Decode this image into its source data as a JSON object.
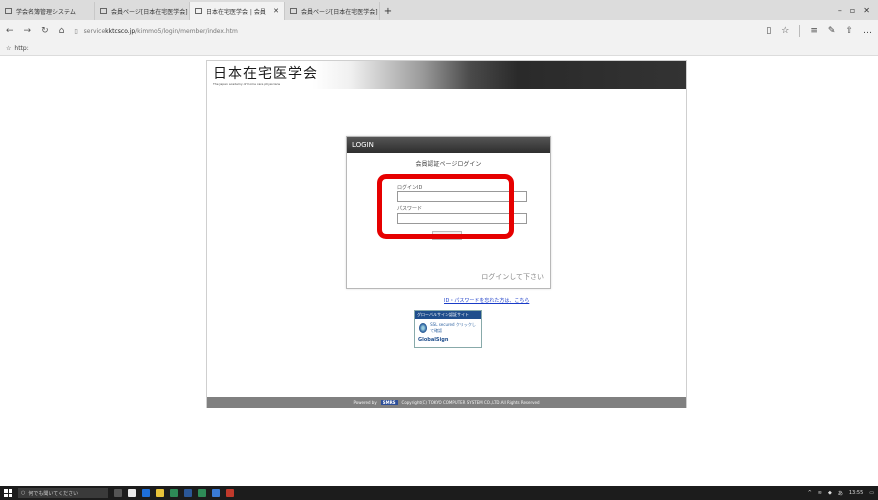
{
  "browser": {
    "tabs": [
      {
        "label": "学会名簿管理システム",
        "active": false
      },
      {
        "label": "会員ページ[日本在宅医学会]",
        "active": false
      },
      {
        "label": "日本在宅医学会 | 会員",
        "active": true
      },
      {
        "label": "会員ページ[日本在宅医学会]",
        "active": false
      }
    ],
    "new_tab_label": "+",
    "window_controls": {
      "minimize": "–",
      "maximize": "▫",
      "close": "✕"
    },
    "url_prefix": "service",
    "url_domain": "kktcsco.jp",
    "url_path": "/kimmo5/login/member/index.htm",
    "favorites_item": "http:"
  },
  "page": {
    "logo": "日本在宅医学会",
    "logo_sub": "The Japan academy of home care physicians",
    "login": {
      "header": "LOGIN",
      "subtitle": "会員認証ページログイン",
      "id_label": "ログインID",
      "password_label": "パスワード",
      "note": "ログインして下さい"
    },
    "forgot_link": "ID・パスワードを忘れた方は、こちら",
    "seal": {
      "top": "グローバルサイン認証サイト",
      "mid": "SSL secured クリックして確認",
      "bottom": "GlobalSign"
    },
    "footer": {
      "powered_by": "Powered by",
      "badge": "SMRS",
      "copyright": "Copyright(C) TOKYO COMPUTER SYSTEM CO.,LTD.All Rights Reserved"
    }
  },
  "taskbar": {
    "search_placeholder": "何でも聞いてください",
    "time": "13:55"
  },
  "colors": {
    "highlight": "#e60000",
    "login_header": "#3a3a3a",
    "footer_bg": "#808080",
    "link": "#1a3cc8",
    "taskbar_bg": "#1c1c1c"
  }
}
